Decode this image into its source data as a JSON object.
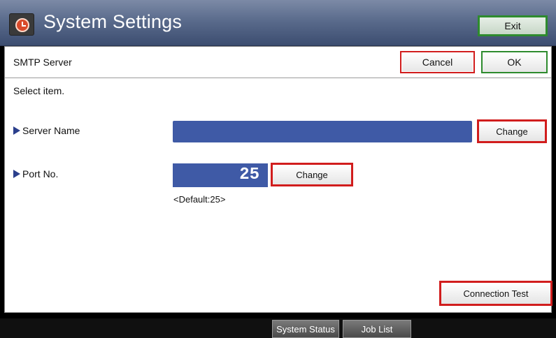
{
  "app": {
    "title": "System Settings",
    "exit_label": "Exit",
    "icon": "clock-icon"
  },
  "screen": {
    "title": "SMTP Server",
    "cancel_label": "Cancel",
    "ok_label": "OK",
    "instruction": "Select item."
  },
  "items": {
    "server_name": {
      "label": "Server Name",
      "value": "",
      "change_label": "Change"
    },
    "port": {
      "label": "Port No.",
      "value": "25",
      "change_label": "Change",
      "default_hint": "<Default:25>"
    }
  },
  "actions": {
    "connection_test_label": "Connection Test"
  },
  "bottom_tabs": {
    "system_status": "System Status",
    "job_list": "Job List"
  },
  "colors": {
    "accent_red": "#d11d1d",
    "accent_green": "#2e8b2e",
    "field_blue": "#3f5aa6"
  }
}
